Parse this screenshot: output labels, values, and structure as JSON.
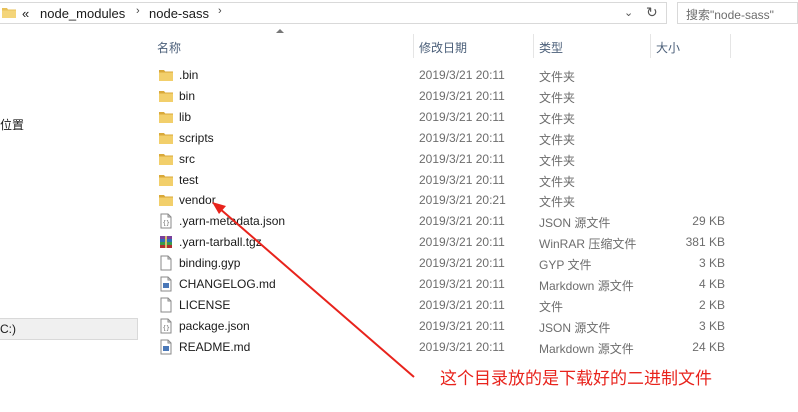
{
  "address_bar": {
    "overflow_glyph": "«",
    "crumbs": [
      "node_modules",
      "node-sass"
    ],
    "separator": "›",
    "dropdown_glyph": "⌄",
    "refresh_glyph": "↻"
  },
  "search": {
    "placeholder": "搜索\"node-sass\""
  },
  "nav_pane": {
    "item_location": "位置",
    "item_drive": "C:)"
  },
  "columns": {
    "name": "名称",
    "date": "修改日期",
    "type": "类型",
    "size": "大小"
  },
  "files": [
    {
      "name": ".bin",
      "date": "2019/3/21 20:11",
      "type": "文件夹",
      "size": "",
      "icon": "folder-icon"
    },
    {
      "name": "bin",
      "date": "2019/3/21 20:11",
      "type": "文件夹",
      "size": "",
      "icon": "folder-icon"
    },
    {
      "name": "lib",
      "date": "2019/3/21 20:11",
      "type": "文件夹",
      "size": "",
      "icon": "folder-icon"
    },
    {
      "name": "scripts",
      "date": "2019/3/21 20:11",
      "type": "文件夹",
      "size": "",
      "icon": "folder-icon"
    },
    {
      "name": "src",
      "date": "2019/3/21 20:11",
      "type": "文件夹",
      "size": "",
      "icon": "folder-icon"
    },
    {
      "name": "test",
      "date": "2019/3/21 20:11",
      "type": "文件夹",
      "size": "",
      "icon": "folder-icon"
    },
    {
      "name": "vendor",
      "date": "2019/3/21 20:21",
      "type": "文件夹",
      "size": "",
      "icon": "folder-icon"
    },
    {
      "name": ".yarn-metadata.json",
      "date": "2019/3/21 20:11",
      "type": "JSON 源文件",
      "size": "29 KB",
      "icon": "json-file-icon"
    },
    {
      "name": ".yarn-tarball.tgz",
      "date": "2019/3/21 20:11",
      "type": "WinRAR 压缩文件",
      "size": "381 KB",
      "icon": "winrar-archive-icon"
    },
    {
      "name": "binding.gyp",
      "date": "2019/3/21 20:11",
      "type": "GYP 文件",
      "size": "3 KB",
      "icon": "blank-file-icon"
    },
    {
      "name": "CHANGELOG.md",
      "date": "2019/3/21 20:11",
      "type": "Markdown 源文件",
      "size": "4 KB",
      "icon": "markdown-file-icon"
    },
    {
      "name": "LICENSE",
      "date": "2019/3/21 20:11",
      "type": "文件",
      "size": "2 KB",
      "icon": "blank-file-icon"
    },
    {
      "name": "package.json",
      "date": "2019/3/21 20:11",
      "type": "JSON 源文件",
      "size": "3 KB",
      "icon": "json-file-icon"
    },
    {
      "name": "README.md",
      "date": "2019/3/21 20:11",
      "type": "Markdown 源文件",
      "size": "24 KB",
      "icon": "markdown-file-icon"
    }
  ],
  "annotation": {
    "text": "这个目录放的是下载好的二进制文件",
    "color": "#e8231c"
  },
  "colors": {
    "header_text": "#4c607a",
    "folder": "#e8c15a",
    "meta_text": "#6d6d6d"
  }
}
